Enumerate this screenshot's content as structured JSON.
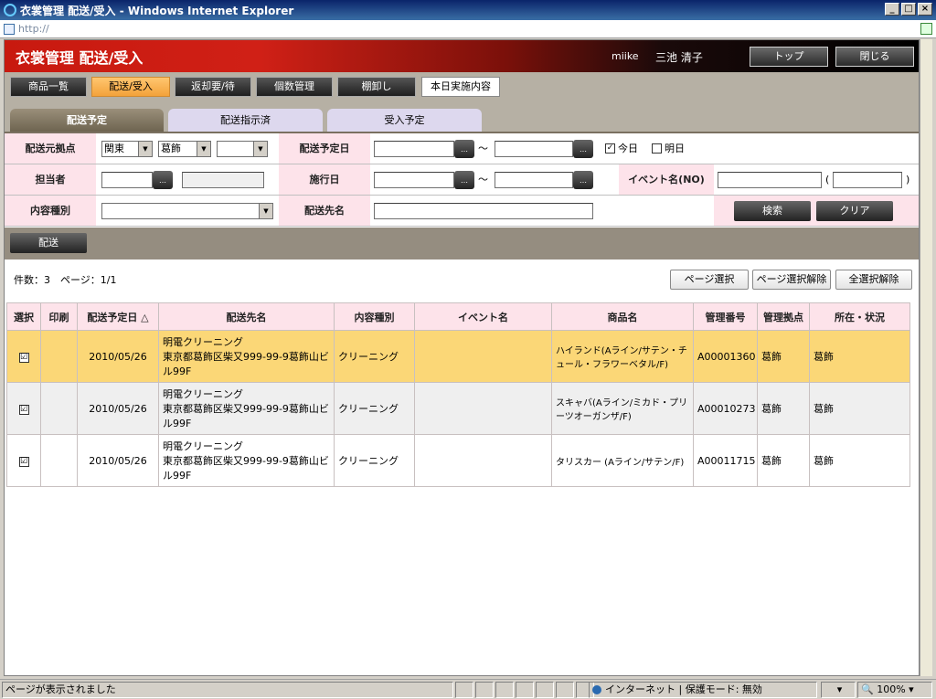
{
  "window": {
    "title": "衣裳管理 配送/受入 - Windows Internet Explorer",
    "address": "http://"
  },
  "app": {
    "title": "衣裳管理 配送/受入",
    "user_id": "miike",
    "user_name": "三池 清子",
    "top_button": "トップ",
    "close_button": "閉じる"
  },
  "menu": [
    {
      "label": "商品一覧"
    },
    {
      "label": "配送/受入"
    },
    {
      "label": "返却要/待"
    },
    {
      "label": "個数管理"
    },
    {
      "label": "棚卸し"
    },
    {
      "label": "本日実施内容"
    }
  ],
  "tabs": [
    {
      "label": "配送予定"
    },
    {
      "label": "配送指示済"
    },
    {
      "label": "受入予定"
    }
  ],
  "search": {
    "origin_label": "配送元拠点",
    "origin_region": "関東",
    "origin_base": "葛飾",
    "origin_extra": "",
    "delivery_date_label": "配送予定日",
    "tilde": "～",
    "today_label": "今日",
    "tomorrow_label": "明日",
    "staff_label": "担当者",
    "event_date_label": "施行日",
    "event_name_label": "イベント名(NO)",
    "paren_open": "(",
    "paren_close": ")",
    "content_type_label": "内容種別",
    "destination_label": "配送先名",
    "search_button": "検索",
    "clear_button": "クリア"
  },
  "actions": {
    "deliver_button": "配送"
  },
  "summary": {
    "count_text": "件数：3　ページ：1/1",
    "page_select": "ページ選択",
    "page_deselect": "ページ選択解除",
    "all_deselect": "全選択解除"
  },
  "grid": {
    "headers": [
      "選択",
      "印刷",
      "配送予定日 △",
      "配送先名",
      "内容種別",
      "イベント名",
      "商品名",
      "管理番号",
      "管理拠点",
      "所在・状況"
    ],
    "rows": [
      {
        "checked": "☑",
        "print": "",
        "date": "2010/05/26",
        "dest": "明電クリーニング\n東京都葛飾区柴又999-99-9葛飾山ビル99F",
        "type": "クリーニング",
        "event": "",
        "product": "ハイランド(Aライン/サテン・チュール・フラワーベタル/F)",
        "code": "A00001360",
        "base": "葛飾",
        "status": "葛飾"
      },
      {
        "checked": "☑",
        "print": "",
        "date": "2010/05/26",
        "dest": "明電クリーニング\n東京都葛飾区柴又999-99-9葛飾山ビル99F",
        "type": "クリーニング",
        "event": "",
        "product": "スキャバ(Aライン/ミカド・プリーツオーガンザ/F)",
        "code": "A00010273",
        "base": "葛飾",
        "status": "葛飾"
      },
      {
        "checked": "☑",
        "print": "",
        "date": "2010/05/26",
        "dest": "明電クリーニング\n東京都葛飾区柴又999-99-9葛飾山ビル99F",
        "type": "クリーニング",
        "event": "",
        "product": "タリスカー (Aライン/サテン/F)",
        "code": "A00011715",
        "base": "葛飾",
        "status": "葛飾"
      }
    ]
  },
  "statusbar": {
    "message": "ページが表示されました",
    "zone": "インターネット | 保護モード: 無効",
    "zoom": "100%"
  }
}
